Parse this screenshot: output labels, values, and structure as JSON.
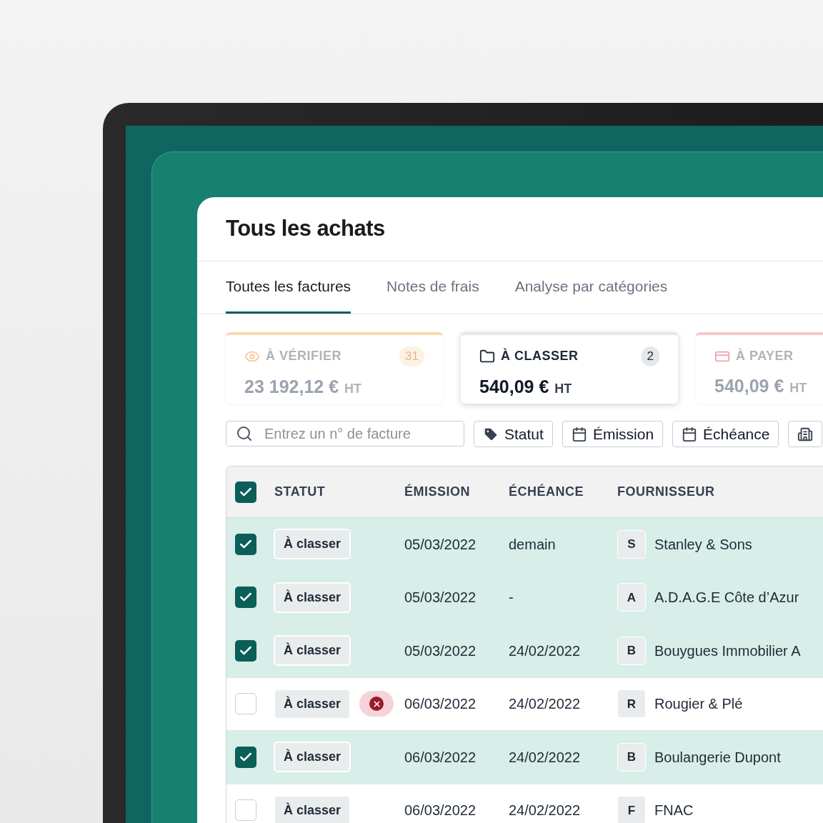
{
  "page": {
    "title": "Tous les achats"
  },
  "tabs": [
    {
      "label": "Toutes les factures",
      "selected": true
    },
    {
      "label": "Notes de frais",
      "selected": false
    },
    {
      "label": "Analyse par catégories",
      "selected": false
    }
  ],
  "summary_cards": [
    {
      "kind": "verify",
      "label": "À VÉRIFIER",
      "count": "31",
      "amount": "23 192,12 €",
      "unit": "HT",
      "selected": false,
      "color": "#fbd9b0"
    },
    {
      "kind": "classify",
      "label": "À CLASSER",
      "count": "2",
      "amount": "540,09 €",
      "unit": "HT",
      "selected": true,
      "color": "#e5e7eb"
    },
    {
      "kind": "pay",
      "label": "À PAYER",
      "amount": "540,09 €",
      "unit": "HT",
      "selected": false,
      "color": "#f8c5cb"
    }
  ],
  "search": {
    "placeholder": "Entrez un n° de facture"
  },
  "filters": [
    {
      "kind": "tag",
      "label": "Statut"
    },
    {
      "kind": "calendar",
      "label": "Émission"
    },
    {
      "kind": "calendar",
      "label": "Échéance"
    },
    {
      "kind": "building"
    }
  ],
  "table": {
    "select_all": {
      "checked": true
    },
    "columns": [
      "STATUT",
      "ÉMISSION",
      "ÉCHÉANCE",
      "FOURNISSEUR"
    ],
    "rows": [
      {
        "checked": true,
        "status": "À classer",
        "error": false,
        "emission": "05/03/2022",
        "echeance": "demain",
        "initial": "S",
        "supplier": "Stanley & Sons"
      },
      {
        "checked": true,
        "status": "À classer",
        "error": false,
        "emission": "05/03/2022",
        "echeance": "-",
        "initial": "A",
        "supplier": "A.D.A.G.E Côte d’Azur"
      },
      {
        "checked": true,
        "status": "À classer",
        "error": false,
        "emission": "05/03/2022",
        "echeance": "24/02/2022",
        "initial": "B",
        "supplier": "Bouygues Immobilier A"
      },
      {
        "checked": false,
        "status": "À classer",
        "error": true,
        "emission": "06/03/2022",
        "echeance": "24/02/2022",
        "initial": "R",
        "supplier": "Rougier & Plé"
      },
      {
        "checked": true,
        "status": "À classer",
        "error": false,
        "emission": "06/03/2022",
        "echeance": "24/02/2022",
        "initial": "B",
        "supplier": "Boulangerie Dupont"
      },
      {
        "checked": false,
        "status": "À classer",
        "error": false,
        "emission": "06/03/2022",
        "echeance": "24/02/2022",
        "initial": "F",
        "supplier": "FNAC"
      }
    ]
  }
}
